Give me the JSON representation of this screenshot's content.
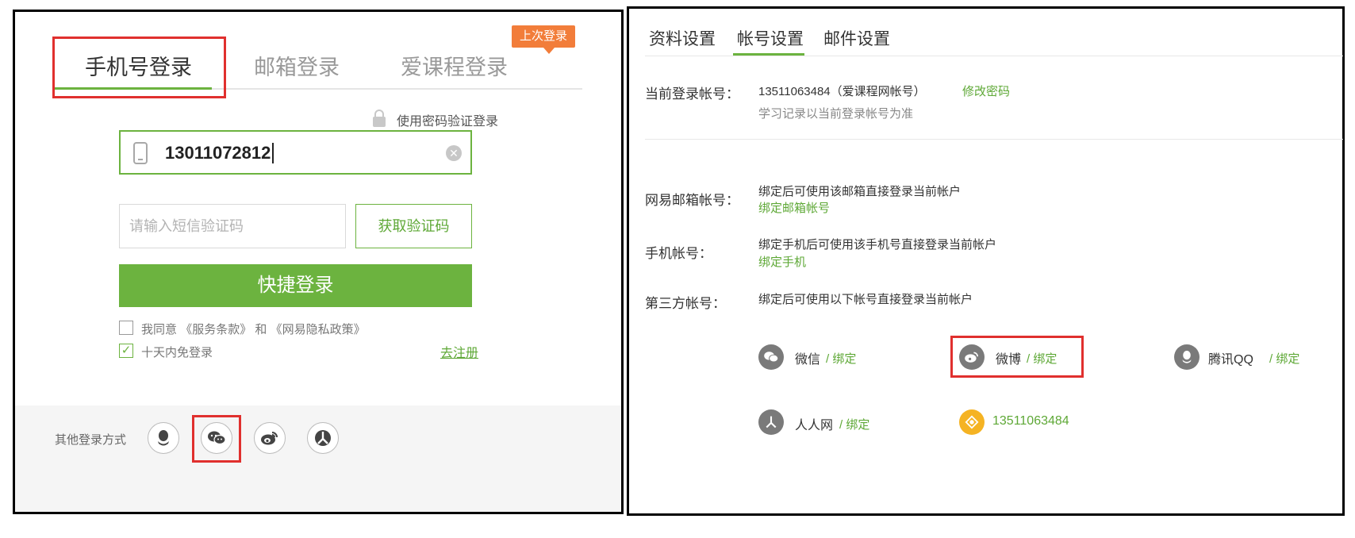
{
  "login": {
    "tabs": [
      "手机号登录",
      "邮箱登录",
      "爱课程登录"
    ],
    "last_login_badge": "上次登录",
    "password_login_link": "使用密码验证登录",
    "phone_value": "13011072812",
    "sms_placeholder": "请输入短信验证码",
    "get_code_button": "获取验证码",
    "quick_login_button": "快捷登录",
    "agree_text": "我同意",
    "terms_link": "《服务条款》",
    "and_text": "和",
    "privacy_link": "《网易隐私政策》",
    "remember_text": "十天内免登录",
    "register_link": "去注册",
    "other_methods_label": "其他登录方式",
    "other_methods_icons": [
      "qq-icon",
      "wechat-icon",
      "weibo-icon",
      "renren-icon"
    ]
  },
  "settings": {
    "tabs": [
      "资料设置",
      "帐号设置",
      "邮件设置"
    ],
    "current_account": {
      "label": "当前登录帐号：",
      "value": "13511063484（爱课程网帐号）",
      "change_password": "修改密码",
      "hint": "学习记录以当前登录帐号为准"
    },
    "netease_email": {
      "label": "网易邮箱帐号：",
      "desc": "绑定后可使用该邮箱直接登录当前帐户",
      "link": "绑定邮箱帐号"
    },
    "mobile": {
      "label": "手机帐号：",
      "desc": "绑定手机后可使用该手机号直接登录当前帐户",
      "link": "绑定手机"
    },
    "third_party": {
      "label": "第三方帐号：",
      "desc": "绑定后可使用以下帐号直接登录当前帐户",
      "items": [
        {
          "name": "微信",
          "action": "/ 绑定",
          "icon": "wechat-icon"
        },
        {
          "name": "微博",
          "action": "/ 绑定",
          "icon": "weibo-icon"
        },
        {
          "name": "腾讯QQ",
          "action": "/ 绑定",
          "icon": "qq-icon"
        },
        {
          "name": "人人网",
          "action": "/ 绑定",
          "icon": "renren-icon"
        },
        {
          "name": "13511063484",
          "action": "",
          "icon": "icourse-icon"
        }
      ]
    }
  },
  "colors": {
    "accent_green": "#6cb33f",
    "badge_orange": "#f27d3a",
    "highlight_red": "#e0302e"
  }
}
